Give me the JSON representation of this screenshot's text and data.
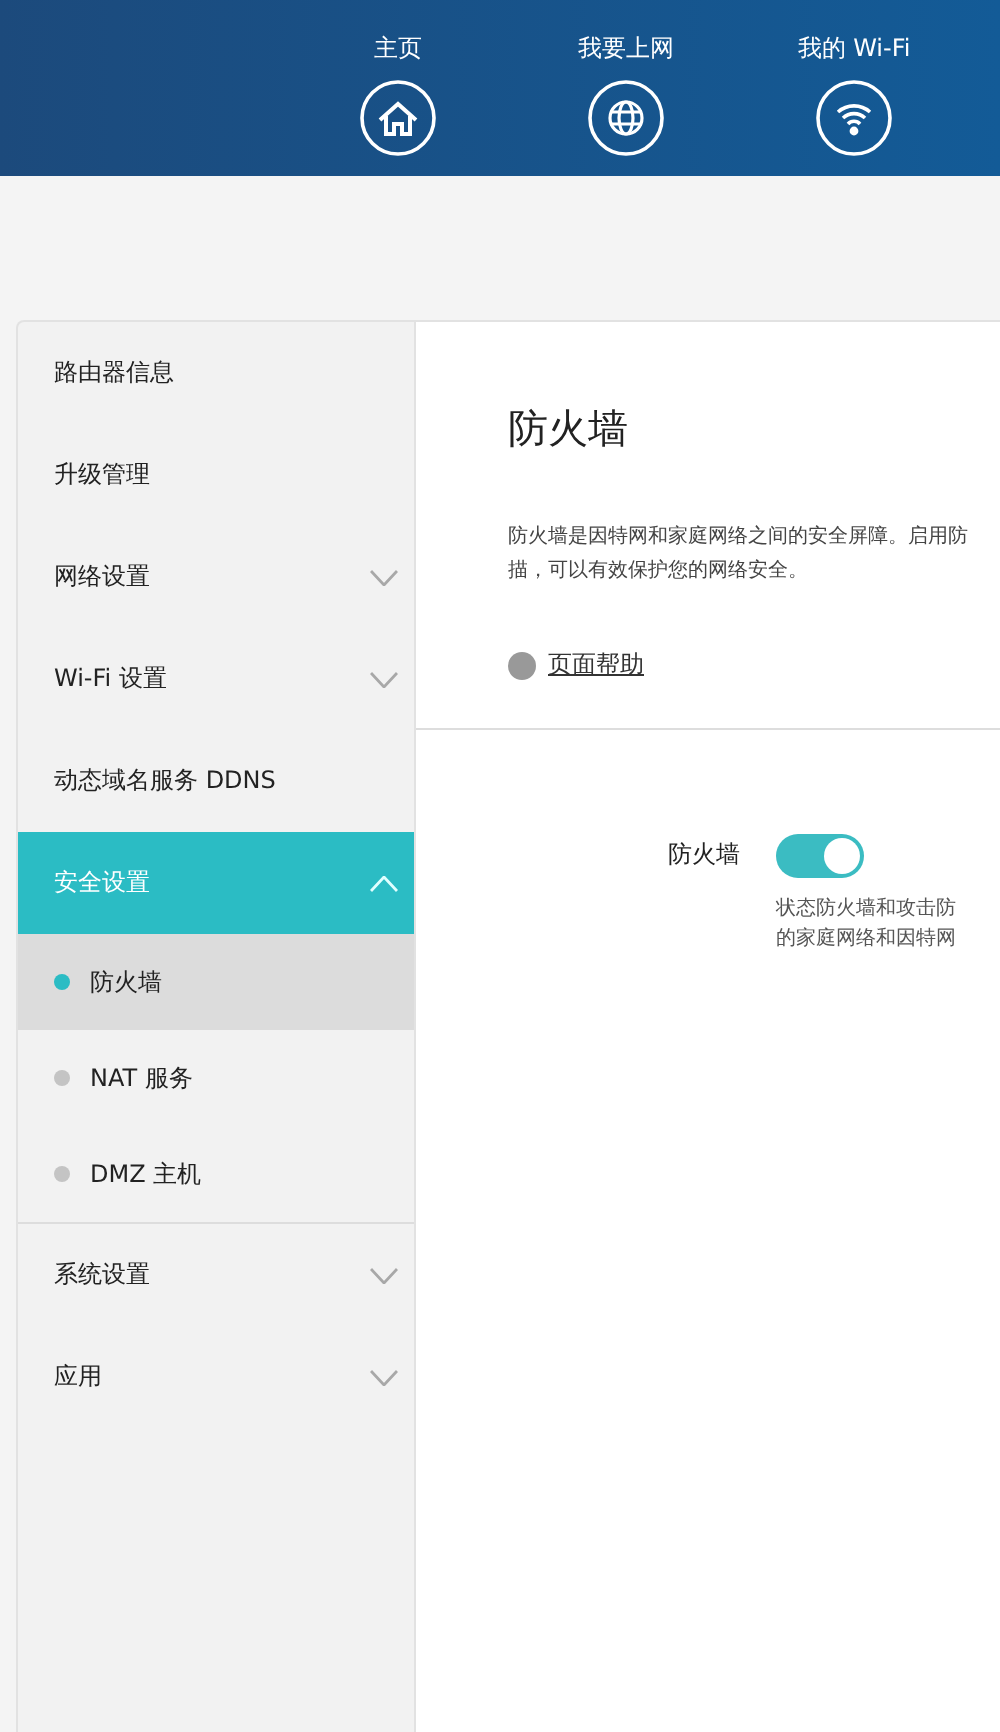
{
  "nav": [
    {
      "label": "主页",
      "kind": "home"
    },
    {
      "label": "我要上网",
      "kind": "globe"
    },
    {
      "label": "我的 Wi-Fi",
      "kind": "wifi"
    }
  ],
  "sidebar": {
    "items": [
      {
        "label": "路由器信息",
        "selected": false
      },
      {
        "label": "升级管理",
        "selected": false
      },
      {
        "label": "网络设置",
        "selected": false,
        "expanded": false
      },
      {
        "label": "Wi-Fi 设置",
        "selected": false,
        "expanded": false
      },
      {
        "label": "动态域名服务 DDNS",
        "selected": false
      },
      {
        "label": "安全设置",
        "selected": true,
        "expanded": true,
        "children": [
          {
            "label": "防火墙",
            "selected": true
          },
          {
            "label": "NAT 服务",
            "selected": false
          },
          {
            "label": "DMZ 主机",
            "selected": false
          }
        ]
      },
      {
        "label": "系统设置",
        "selected": false,
        "expanded": false
      },
      {
        "label": "应用",
        "selected": false,
        "expanded": false
      }
    ]
  },
  "content": {
    "title": "防火墙",
    "description_lines": [
      "防火墙是因特网和家庭网络之间的安全屏障。启用防",
      "描，可以有效保护您的网络安全。"
    ],
    "help_link": "页面帮助",
    "setting": {
      "label": "防火墙",
      "on": true,
      "note_lines": [
        "状态防火墙和攻击防",
        "的家庭网络和因特网"
      ]
    }
  }
}
